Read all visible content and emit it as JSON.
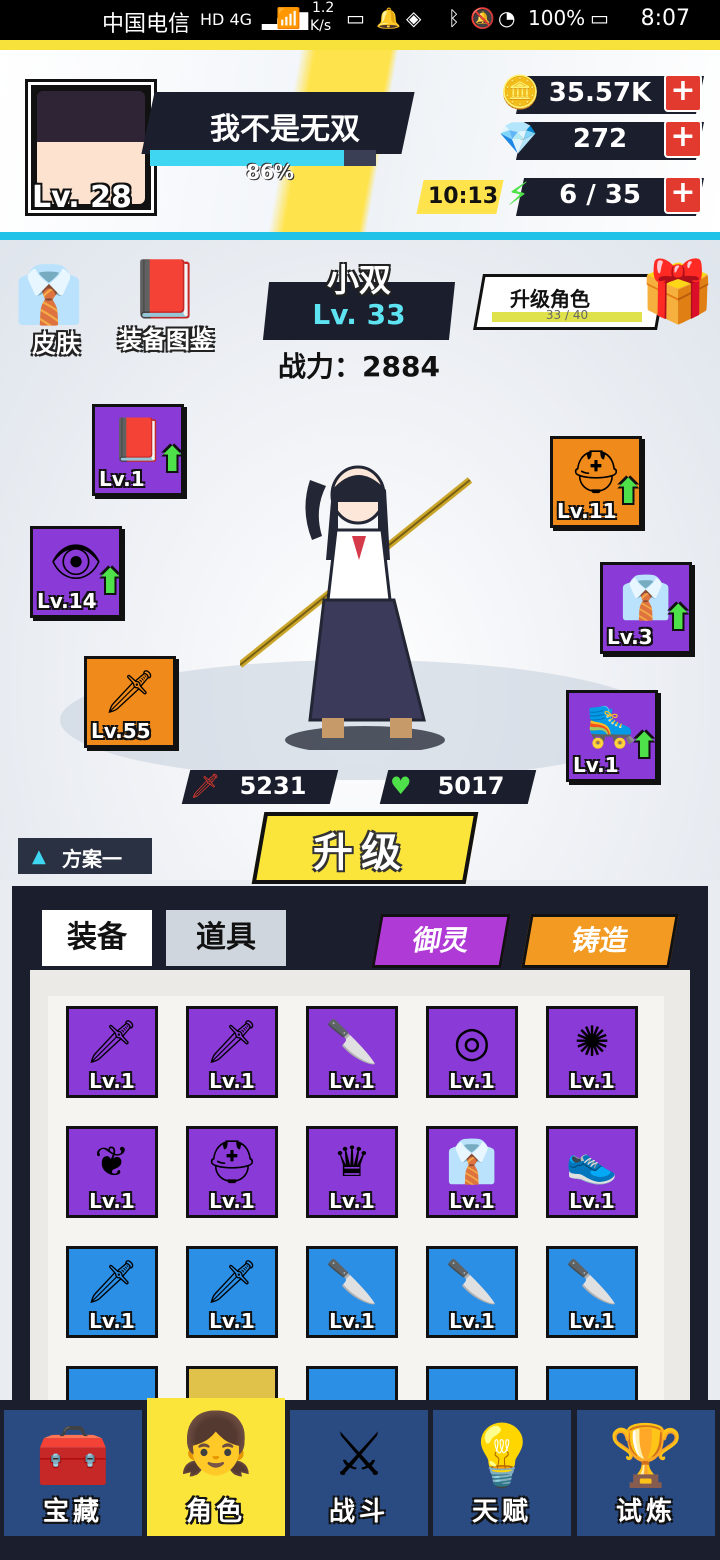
{
  "status_bar": {
    "carrier": "中国电信",
    "network": "HD 4G",
    "speed_top": "1.2",
    "speed_bottom": "K/s",
    "battery": "100%",
    "time": "8:07"
  },
  "header": {
    "player_level": "Lv. 28",
    "player_name": "我不是无双",
    "exp_percent_text": "86%",
    "exp_fraction": 0.86,
    "coins": "35.57K",
    "gems": "272",
    "energy_timer": "10:13",
    "energy": "6 / 35",
    "plus_symbol": "+",
    "icons": {
      "coin": "paw-coin-icon",
      "gem": "blue-crystal-icon",
      "energy": "lightning-icon"
    }
  },
  "character": {
    "name": "小双",
    "level": "Lv. 33",
    "power": "战力：2884",
    "attack": "5231",
    "hp": "5017",
    "skin_label": "皮肤",
    "handbook_label": "装备图鉴",
    "upgrade_role_label": "升级角色",
    "upgrade_role_progress": "33 / 40",
    "upgrade_role_fraction": 0.825,
    "upgrade_button": "升级",
    "scheme_label": "方案一"
  },
  "equipped": {
    "left": [
      {
        "level": "Lv.1",
        "name": "book-icon",
        "upgradable": true
      },
      {
        "level": "Lv.14",
        "name": "eyeball-icon",
        "upgradable": true
      },
      {
        "level": "Lv.55",
        "name": "sword-icon",
        "upgradable": false
      }
    ],
    "right": [
      {
        "level": "Lv.11",
        "name": "helmet-icon",
        "upgradable": true
      },
      {
        "level": "Lv.3",
        "name": "uniform-icon",
        "upgradable": true
      },
      {
        "level": "Lv.1",
        "name": "roller-skate-icon",
        "upgradable": true
      }
    ]
  },
  "inventory": {
    "tabs": [
      "装备",
      "道具"
    ],
    "actions": [
      "御灵",
      "铸造"
    ],
    "rows": [
      [
        {
          "level": "Lv.1",
          "color": "purple",
          "icon": "blue-blade-icon"
        },
        {
          "level": "Lv.1",
          "color": "purple",
          "icon": "blue-blade-icon"
        },
        {
          "level": "Lv.1",
          "color": "purple",
          "icon": "dark-blade-icon"
        },
        {
          "level": "Lv.1",
          "color": "purple",
          "icon": "dark-ring-icon"
        },
        {
          "level": "Lv.1",
          "color": "purple",
          "icon": "spiked-collar-icon"
        }
      ],
      [
        {
          "level": "Lv.1",
          "color": "purple",
          "icon": "jade-pendant-icon"
        },
        {
          "level": "Lv.1",
          "color": "purple",
          "icon": "horned-helmet-icon"
        },
        {
          "level": "Lv.1",
          "color": "purple",
          "icon": "crown-icon"
        },
        {
          "level": "Lv.1",
          "color": "purple",
          "icon": "uniform-icon"
        },
        {
          "level": "Lv.1",
          "color": "purple",
          "icon": "pink-sneaker-icon"
        }
      ],
      [
        {
          "level": "Lv.1",
          "color": "blue",
          "icon": "red-blade-icon"
        },
        {
          "level": "Lv.1",
          "color": "blue",
          "icon": "red-blade-icon"
        },
        {
          "level": "Lv.1",
          "color": "blue",
          "icon": "dark-blade-icon"
        },
        {
          "level": "Lv.1",
          "color": "blue",
          "icon": "white-blade-icon"
        },
        {
          "level": "Lv.1",
          "color": "blue",
          "icon": "white-blade-icon"
        }
      ]
    ]
  },
  "nav": [
    {
      "label": "宝藏",
      "icon": "treasure-chest-icon",
      "active": false
    },
    {
      "label": "角色",
      "icon": "character-avatar-icon",
      "active": true
    },
    {
      "label": "战斗",
      "icon": "crossed-swords-icon",
      "active": false
    },
    {
      "label": "天赋",
      "icon": "light-bulb-icon",
      "active": false
    },
    {
      "label": "试炼",
      "icon": "winged-trophy-icon",
      "active": false
    }
  ]
}
